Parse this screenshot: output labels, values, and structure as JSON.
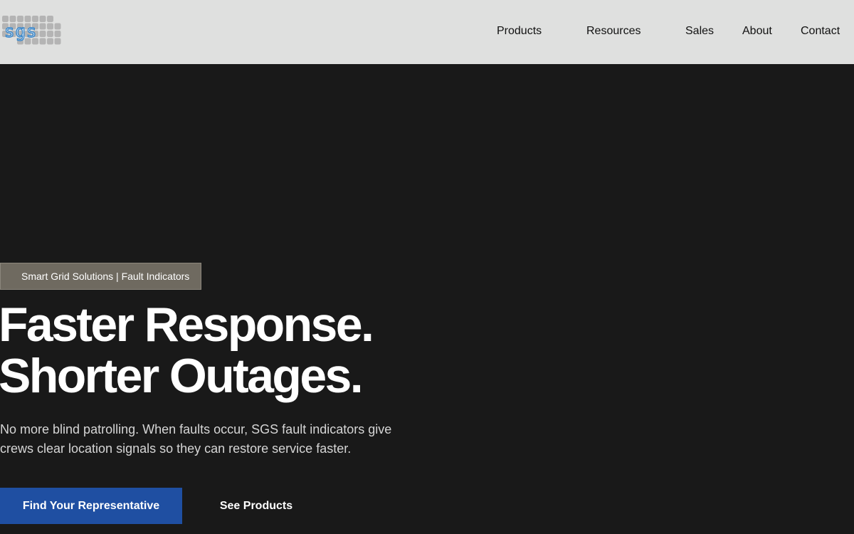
{
  "brand": {
    "logo_text": "sgs",
    "logo_tile_color": "#b4b4b4",
    "logo_letter_color": "#3a86c8"
  },
  "nav": {
    "items": [
      {
        "label": "Products"
      },
      {
        "label": "Resources"
      },
      {
        "label": "Sales"
      },
      {
        "label": "About"
      },
      {
        "label": "Contact"
      }
    ]
  },
  "hero": {
    "eyebrow": "Smart Grid Solutions | Fault Indicators",
    "headline_line1": "Faster Response.",
    "headline_line2": "Shorter Outages.",
    "subtext": "No more blind patrolling. When faults occur, SGS fault indicators give crews clear location signals so they can restore service faster.",
    "primary_cta": "Find Your Representative",
    "secondary_cta": "See Products"
  },
  "colors": {
    "header_bg": "#dfe0df",
    "hero_bg": "#191919",
    "accent_blue": "#1f4fa2",
    "eyebrow_bg": "#6f6a60"
  }
}
